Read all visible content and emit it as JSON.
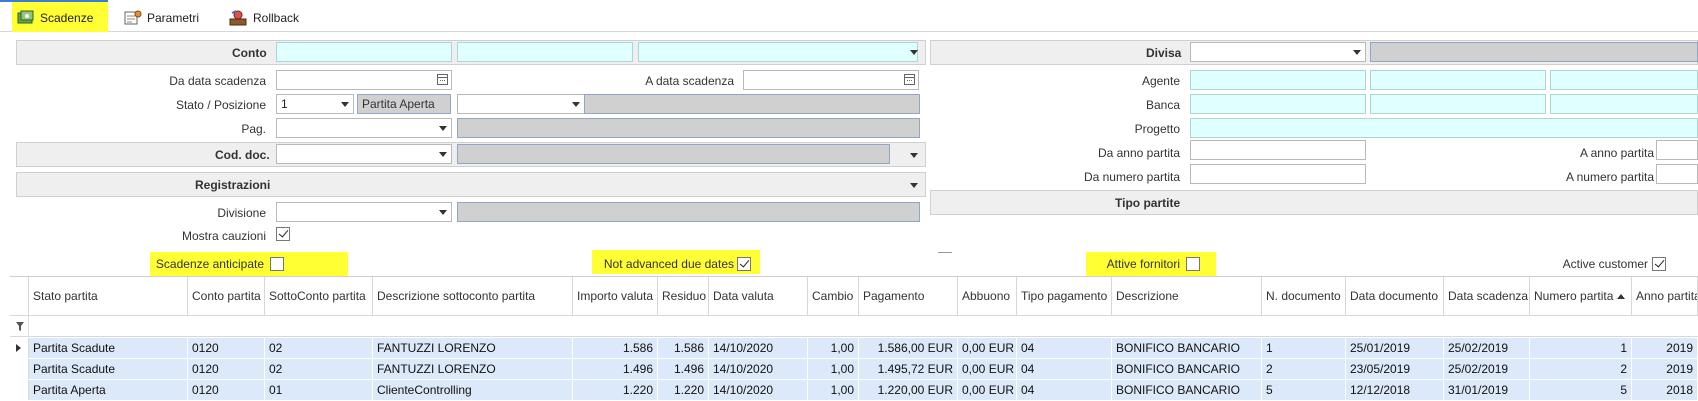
{
  "toolbar": {
    "items": [
      {
        "label": "Scadenze",
        "icon": "scadenze-icon"
      },
      {
        "label": "Parametri",
        "icon": "parametri-icon"
      },
      {
        "label": "Rollback",
        "icon": "rollback-icon"
      }
    ]
  },
  "left": {
    "conto_label": "Conto",
    "da_data_scadenza_label": "Da data scadenza",
    "a_data_scadenza_label": "A data scadenza",
    "stato_posizione_label": "Stato / Posizione",
    "stato_value": "1",
    "stato_text": "Partita Aperta",
    "pag_label": "Pag.",
    "cod_doc_label": "Cod. doc.",
    "registrazioni_label": "Registrazioni",
    "divisione_label": "Divisione",
    "mostra_cauzioni_label": "Mostra cauzioni"
  },
  "right": {
    "divisa_label": "Divisa",
    "agente_label": "Agente",
    "banca_label": "Banca",
    "progetto_label": "Progetto",
    "da_anno_label": "Da anno partita",
    "a_anno_label": "A anno partita",
    "da_numero_label": "Da numero partita",
    "a_numero_label": "A numero partita",
    "tipo_partite_label": "Tipo partite"
  },
  "options": {
    "scadenze_anticipate": "Scadenze anticipate",
    "not_advanced": "Not advanced due dates",
    "attive_fornitori": "Attive fornitori",
    "active_customer": "Active customer"
  },
  "grid": {
    "columns": [
      "Stato partita",
      "Conto partita",
      "SottoConto partita",
      "Descrizione sottoconto partita",
      "Importo valuta",
      "Residuo",
      "Data valuta",
      "Cambio",
      "Pagamento",
      "Abbuono",
      "Tipo pagamento",
      "Descrizione",
      "N. documento",
      "Data documento",
      "Data scadenza",
      "Numero partita",
      "Anno partita"
    ],
    "rows": [
      [
        "Partita Scadute",
        "0120",
        "02",
        "FANTUZZI LORENZO",
        "1.586",
        "1.586",
        "14/10/2020",
        "1,00",
        "1.586,00 EUR",
        "0,00 EUR",
        "04",
        "BONIFICO BANCARIO",
        "1",
        "25/01/2019",
        "25/02/2019",
        "1",
        "2019"
      ],
      [
        "Partita Scadute",
        "0120",
        "02",
        "FANTUZZI LORENZO",
        "1.496",
        "1.496",
        "14/10/2020",
        "1,00",
        "1.495,72 EUR",
        "0,00 EUR",
        "04",
        "BONIFICO BANCARIO",
        "2",
        "23/05/2019",
        "25/02/2019",
        "2",
        "2019"
      ],
      [
        "Partita Aperta",
        "0120",
        "01",
        "ClienteControlling",
        "1.220",
        "1.220",
        "14/10/2020",
        "1,00",
        "1.220,00 EUR",
        "0,00 EUR",
        "04",
        "BONIFICO BANCARIO",
        "5",
        "12/12/2018",
        "31/01/2019",
        "5",
        "2018"
      ]
    ]
  },
  "colors": {
    "highlight": "#ffff33",
    "cyan_field": "#e0ffff",
    "row_bg": "#dce9fb"
  }
}
